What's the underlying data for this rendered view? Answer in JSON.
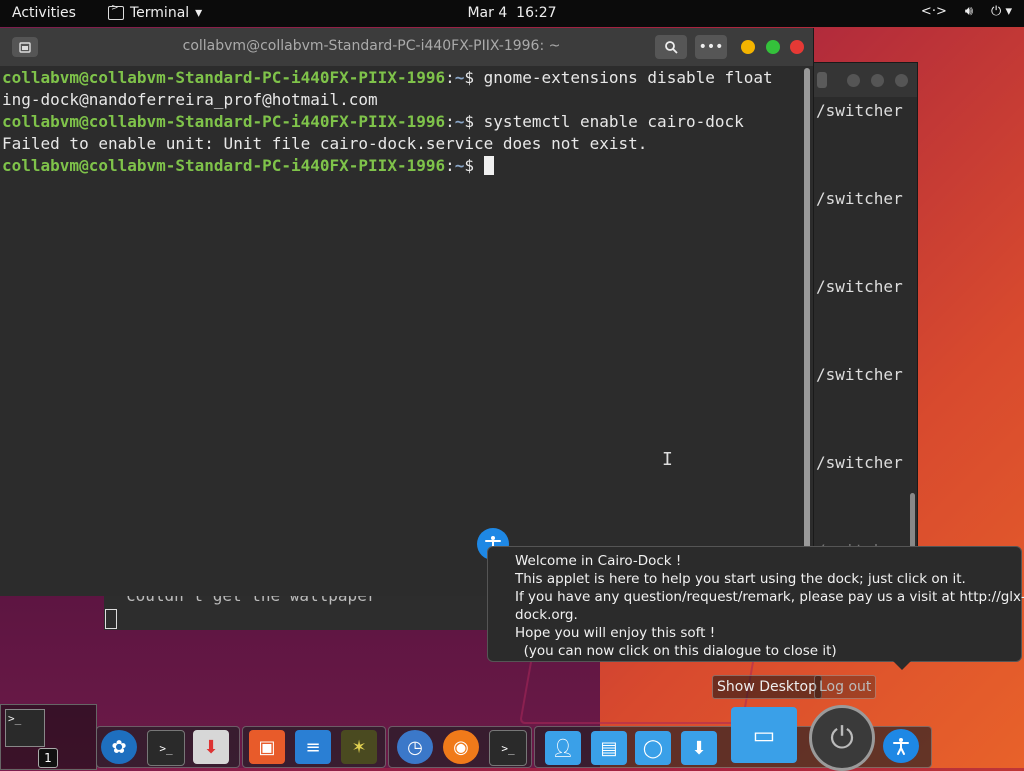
{
  "topbar": {
    "activities": "Activities",
    "app_name": "Terminal",
    "date": "Mar 4",
    "time": "16:27",
    "tray": [
      "network-icon",
      "volume-icon",
      "power-icon"
    ]
  },
  "terminal": {
    "title": "collabvm@collabvm-Standard-PC-i440FX-PIIX-1996: ~",
    "lines": [
      {
        "user": "collabvm@collabvm-Standard-PC-i440FX-PIIX-1996",
        "path": "~",
        "cmd": " gnome-extensions disable float"
      },
      {
        "text": "ing-dock@nandoferreira_prof@hotmail.com"
      },
      {
        "user": "collabvm@collabvm-Standard-PC-i440FX-PIIX-1996",
        "path": "~",
        "cmd": " systemctl enable cairo-dock"
      },
      {
        "text": "Failed to enable unit: Unit file cairo-dock.service does not exist."
      },
      {
        "user": "collabvm@collabvm-Standard-PC-i440FX-PIIX-1996",
        "path": "~",
        "cmd": " "
      }
    ]
  },
  "back_terminal": {
    "lines": [
      "/switcher",
      "/switcher",
      "/switcher",
      "/switcher",
      "/switcher",
      "/switcher"
    ]
  },
  "lower_terminal": {
    "text": "couldn't get the wallpaper"
  },
  "cairo_dialog": {
    "lines": [
      "Welcome in Cairo-Dock !",
      "This applet is here to help you start using the dock; just click on it.",
      "If you have any question/request/remark, please pay us a visit at http://glx-",
      "dock.org.",
      "Hope you will enjoy this soft !",
      "  (you can now click on this dialogue to close it)"
    ]
  },
  "dock": {
    "tooltip_show_desktop": "Show Desktop",
    "tooltip_logout": "Log out",
    "workspace_number": "1",
    "workspace_preview_text": ">_",
    "colors": {
      "accent": "#1e88e5",
      "folder": "#3aa0e8"
    }
  }
}
